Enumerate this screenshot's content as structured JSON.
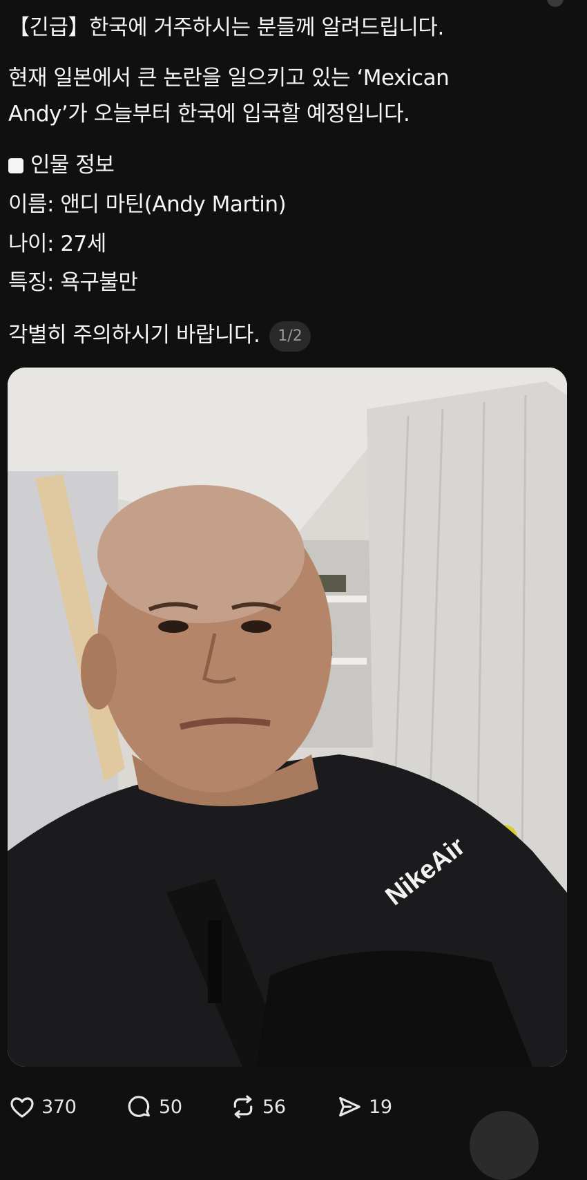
{
  "post": {
    "lines": [
      "【긴급】한국에 거주하시는 분들께 알려드립니다.",
      "현재 일본에서 큰 논란을 일으키고 있는 ‘Mexican",
      "Andy’가 오늘부터 한국에 입국할 예정입니다.",
      "인물 정보",
      "이름: 앤디 마틴(Andy Martin)",
      "나이: 27세",
      "특징: 욕구불만",
      "각별히 주의하시기 바랍니다."
    ],
    "page_indicator": "1/2"
  },
  "media": {
    "shirt_logo_text": "NikeAir"
  },
  "actions": {
    "likes": "370",
    "replies": "50",
    "reposts": "56",
    "shares": "19"
  },
  "colors": {
    "background": "#101010",
    "text": "#f3f5f7",
    "badge_bg": "#2a2a2a"
  }
}
